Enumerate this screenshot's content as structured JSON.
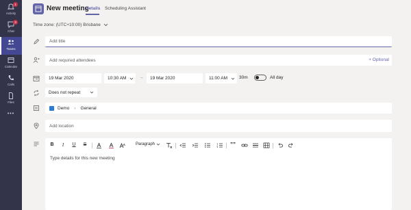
{
  "rail": {
    "items": [
      {
        "label": "Activity",
        "badge": "1",
        "icon": "bell-icon"
      },
      {
        "label": "Chat",
        "badge": "3",
        "icon": "chat-icon"
      },
      {
        "label": "Teams",
        "badge": "",
        "icon": "teams-icon"
      },
      {
        "label": "Calendar",
        "badge": "",
        "icon": "calendar-icon"
      },
      {
        "label": "Calls",
        "badge": "",
        "icon": "phone-icon"
      },
      {
        "label": "Files",
        "badge": "",
        "icon": "file-icon"
      }
    ],
    "more": "•••",
    "active_color": "#444791"
  },
  "header": {
    "title": "New meeting",
    "tabs": [
      "Details",
      "Scheduling Assistant"
    ]
  },
  "timezone": "Time zone: (UTC+10:00) Brisbane",
  "form": {
    "title_placeholder": "Add title",
    "attendees_placeholder": "Add required attendees",
    "optional": "+ Optional",
    "start_date": "19 Mar 2020",
    "start_time": "10:30 AM",
    "end_date": "19 Mar 2020",
    "end_time": "11:00 AM",
    "duration": "30m",
    "all_day": "All day",
    "repeat": "Does not repeat",
    "channel_team": "Demo",
    "channel_name": "General",
    "location_placeholder": "Add location",
    "details_placeholder": "Type details for this new meeting"
  },
  "toolbar": {
    "bold": "B",
    "italic": "I",
    "underline": "U",
    "strike": "S",
    "paragraph": "Paragraph",
    "quote": "””"
  },
  "colors": {
    "accent": "#6264a7",
    "rail": "#33344a",
    "badge": "#c4314b"
  }
}
